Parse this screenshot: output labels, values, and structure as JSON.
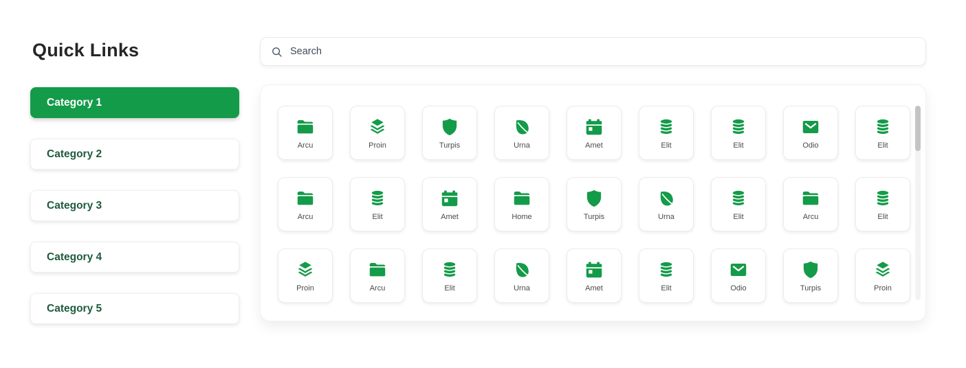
{
  "sidebar": {
    "title": "Quick Links",
    "categories": [
      {
        "label": "Category 1",
        "active": true
      },
      {
        "label": "Category 2",
        "active": false
      },
      {
        "label": "Category 3",
        "active": false
      },
      {
        "label": "Category 4",
        "active": false
      },
      {
        "label": "Category 5",
        "active": false
      }
    ]
  },
  "search": {
    "placeholder": "Search",
    "value": "",
    "icon": "search-icon"
  },
  "colors": {
    "primary_green": "#149B49",
    "category_text_green": "#1E5B3C"
  },
  "grid": {
    "columns": 9,
    "tiles": [
      {
        "label": "Arcu",
        "icon": "folder"
      },
      {
        "label": "Proin",
        "icon": "layers"
      },
      {
        "label": "Turpis",
        "icon": "shield"
      },
      {
        "label": "Urna",
        "icon": "leaf"
      },
      {
        "label": "Amet",
        "icon": "calendar"
      },
      {
        "label": "Elit",
        "icon": "database"
      },
      {
        "label": "Elit",
        "icon": "database"
      },
      {
        "label": "Odio",
        "icon": "mail"
      },
      {
        "label": "Elit",
        "icon": "database"
      },
      {
        "label": "Arcu",
        "icon": "folder"
      },
      {
        "label": "Elit",
        "icon": "database"
      },
      {
        "label": "Amet",
        "icon": "calendar"
      },
      {
        "label": "Home",
        "icon": "folder"
      },
      {
        "label": "Turpis",
        "icon": "shield"
      },
      {
        "label": "Urna",
        "icon": "leaf"
      },
      {
        "label": "Elit",
        "icon": "database"
      },
      {
        "label": "Arcu",
        "icon": "folder"
      },
      {
        "label": "Elit",
        "icon": "database"
      },
      {
        "label": "Proin",
        "icon": "layers"
      },
      {
        "label": "Arcu",
        "icon": "folder"
      },
      {
        "label": "Elit",
        "icon": "database"
      },
      {
        "label": "Urna",
        "icon": "leaf"
      },
      {
        "label": "Amet",
        "icon": "calendar"
      },
      {
        "label": "Elit",
        "icon": "database"
      },
      {
        "label": "Odio",
        "icon": "mail"
      },
      {
        "label": "Turpis",
        "icon": "shield"
      },
      {
        "label": "Proin",
        "icon": "layers"
      }
    ]
  }
}
